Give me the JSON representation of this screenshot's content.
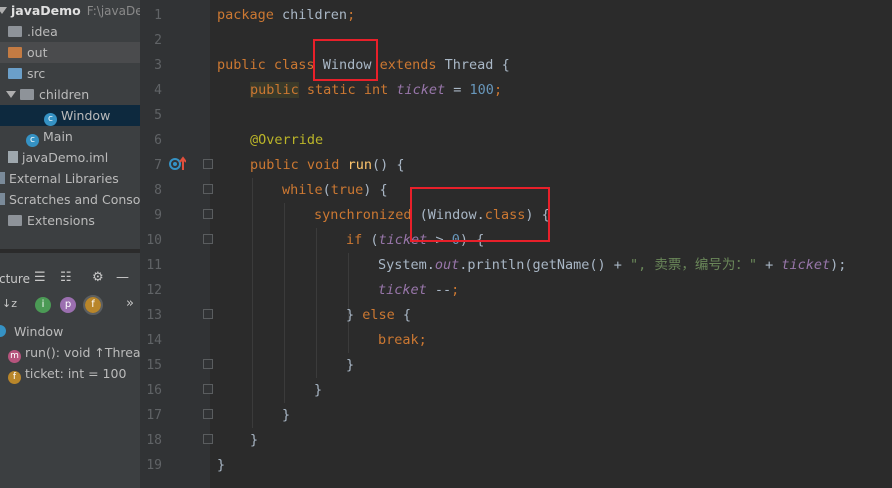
{
  "project_tree": {
    "root": {
      "name": "javaDemo",
      "path": "F:\\javaDem"
    },
    "items": [
      {
        "label": ".idea"
      },
      {
        "label": "out"
      },
      {
        "label": "src"
      },
      {
        "label": "children"
      },
      {
        "label": "Window"
      },
      {
        "label": "Main"
      },
      {
        "label": "javaDemo.iml"
      },
      {
        "label": "External Libraries"
      },
      {
        "label": "Scratches and Console"
      },
      {
        "label": "Extensions"
      }
    ]
  },
  "structure": {
    "header_label": "cture",
    "class_name": "Window",
    "members": [
      {
        "label": "run(): void ↑Threa"
      },
      {
        "label": "ticket: int = 100"
      }
    ]
  },
  "editor": {
    "line_numbers": [
      "1",
      "2",
      "3",
      "4",
      "5",
      "6",
      "7",
      "8",
      "9",
      "10",
      "11",
      "12",
      "13",
      "14",
      "15",
      "16",
      "17",
      "18",
      "19"
    ],
    "code": {
      "l1_package": "package",
      "l1_name": " children",
      "l1_semi": ";",
      "l3_public": "public",
      "l3_class": "class",
      "l3_name": "Window",
      "l3_extends": "extends",
      "l3_super": "Thread {",
      "l4_public": "public",
      "l4_static": "static",
      "l4_int": "int",
      "l4_ticket": "ticket",
      "l4_eq": " = ",
      "l4_val": "100",
      "l4_semi": ";",
      "l6_ann": "@Override",
      "l7_public": "public",
      "l7_void": "void",
      "l7_run": "run",
      "l7_rest": "() {",
      "l8_while": "while",
      "l8_open": "(",
      "l8_true": "true",
      "l8_rest": ") {",
      "l9_sync": "synchronized",
      "l9_open": " (Window.",
      "l9_class": "class",
      "l9_rest": ") {",
      "l10_if": "if",
      "l10_open": " (",
      "l10_ticket": "ticket",
      "l10_gt": " > ",
      "l10_zero": "0",
      "l10_rest": ") {",
      "l11_sys": "System.",
      "l11_out": "out",
      "l11_print": ".println(getName() + ",
      "l11_str": "\", 卖票，编号为：\"",
      "l11_plus": " + ",
      "l11_ticket": "ticket",
      "l11_rest": ");",
      "l12_ticket": "ticket",
      "l12_dec": " --",
      "l12_semi": ";",
      "l13_close": "} ",
      "l13_else": "else",
      "l13_rest": " {",
      "l14_break": "break",
      "l14_semi": ";",
      "l15": "}",
      "l16": "}",
      "l17": "}",
      "l18": "}",
      "l19": "}"
    }
  },
  "colors": {
    "keyword": "#cc7832",
    "number": "#6897bb",
    "field": "#9876aa",
    "string": "#6a8759",
    "annotation": "#bbb529",
    "highlight_box": "#e8202a"
  }
}
